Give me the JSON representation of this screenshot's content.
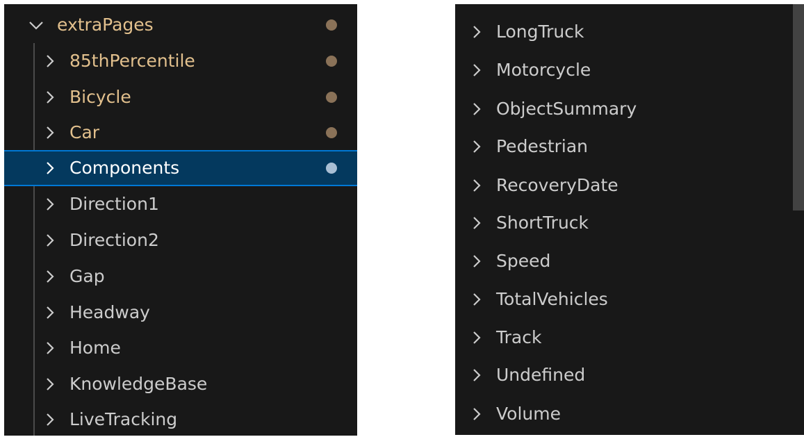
{
  "left_panel": {
    "folder": {
      "label": "extraPages",
      "expanded": true
    },
    "items": [
      {
        "label": "85thPercentile",
        "status": "modified"
      },
      {
        "label": "Bicycle",
        "status": "modified"
      },
      {
        "label": "Car",
        "status": "modified"
      },
      {
        "label": "Components",
        "status": "modified",
        "selected": true
      },
      {
        "label": "Direction1"
      },
      {
        "label": "Direction2"
      },
      {
        "label": "Gap"
      },
      {
        "label": "Headway"
      },
      {
        "label": "Home"
      },
      {
        "label": "KnowledgeBase"
      },
      {
        "label": "LiveTracking"
      }
    ]
  },
  "right_panel": {
    "items": [
      {
        "label": "LongTruck"
      },
      {
        "label": "Motorcycle"
      },
      {
        "label": "ObjectSummary"
      },
      {
        "label": "Pedestrian"
      },
      {
        "label": "RecoveryDate"
      },
      {
        "label": "ShortTruck"
      },
      {
        "label": "Speed"
      },
      {
        "label": "TotalVehicles"
      },
      {
        "label": "Track"
      },
      {
        "label": "Undefined"
      },
      {
        "label": "Volume"
      }
    ]
  },
  "colors": {
    "background": "#181818",
    "text": "#cccccc",
    "modified_text": "#e2c08d",
    "selection": "#04395e",
    "focus_border": "#0078d4"
  }
}
